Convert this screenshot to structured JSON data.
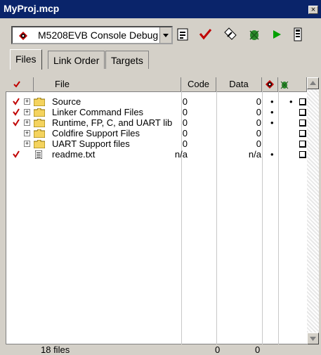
{
  "window": {
    "title": "MyProj.mcp",
    "close_label": "×"
  },
  "toolbar": {
    "target": "M5208EVB Console Debug",
    "icons": [
      "target-settings-icon",
      "synchronize-icon",
      "make-icon",
      "debug-icon",
      "run-icon",
      "project-inspector-icon"
    ]
  },
  "tabs": [
    {
      "label": "Files",
      "active": true
    },
    {
      "label": "Link Order",
      "active": false
    },
    {
      "label": "Targets",
      "active": false
    }
  ],
  "columns": {
    "file": "File",
    "code": "Code",
    "data": "Data"
  },
  "rows": [
    {
      "name": "Source",
      "code": "0",
      "data": "0",
      "dot1": "•",
      "dot2": "•",
      "checked": true,
      "folder": true
    },
    {
      "name": "Linker Command Files",
      "code": "0",
      "data": "0",
      "dot1": "•",
      "dot2": "",
      "checked": true,
      "folder": true
    },
    {
      "name": "Runtime, FP, C, and UART lib",
      "code": "0",
      "data": "0",
      "dot1": "•",
      "dot2": "",
      "checked": true,
      "folder": true
    },
    {
      "name": "Coldfire Support Files",
      "code": "0",
      "data": "0",
      "dot1": "",
      "dot2": "",
      "checked": false,
      "folder": true
    },
    {
      "name": "UART Support files",
      "code": "0",
      "data": "0",
      "dot1": "",
      "dot2": "",
      "checked": false,
      "folder": true
    },
    {
      "name": "readme.txt",
      "code": "n/a",
      "data": "n/a",
      "dot1": "•",
      "dot2": "",
      "checked": true,
      "folder": false
    }
  ],
  "status": {
    "files": "18 files",
    "code_total": "0",
    "data_total": "0"
  },
  "colors": {
    "titlebar": "#0a246a",
    "face": "#d4d0c8",
    "check": "#c00000",
    "folder": "#f4d35e"
  }
}
